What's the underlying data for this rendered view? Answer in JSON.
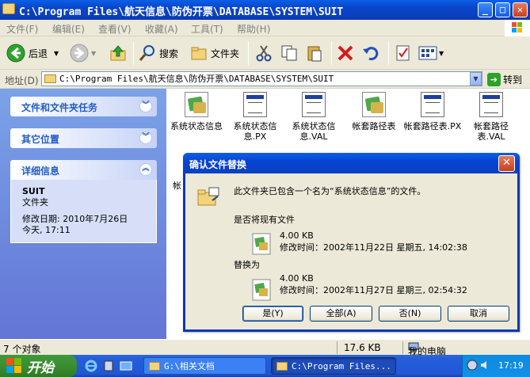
{
  "window": {
    "title": "C:\\Program Files\\航天信息\\防伪开票\\DATABASE\\SYSTEM\\SUIT",
    "controls": {
      "minimize": "_",
      "maximize": "□",
      "close": "✕"
    }
  },
  "menu": [
    "文件(F)",
    "编辑(E)",
    "查看(V)",
    "收藏(A)",
    "工具(T)",
    "帮助(H)"
  ],
  "toolbar": {
    "back": "后退",
    "search": "搜索",
    "folders": "文件夹"
  },
  "address": {
    "label": "地址(D)",
    "value": "C:\\Program Files\\航天信息\\防伪开票\\DATABASE\\SYSTEM\\SUIT",
    "go": "转到"
  },
  "sidebar": {
    "tasks_title": "文件和文件夹任务",
    "other_title": "其它位置",
    "details_title": "详细信息",
    "details": {
      "name": "SUIT",
      "type": "文件夹",
      "modified_label": "修改日期: 2010年7月26日",
      "modified_time": "今天, 17:11"
    }
  },
  "files": [
    {
      "name": "系统状态信息",
      "icon": "registry-icon"
    },
    {
      "name": "系统状态信息.PX",
      "icon": "document-icon"
    },
    {
      "name": "系统状态信息.VAL",
      "icon": "document-icon"
    },
    {
      "name": "帐套路径表",
      "icon": "registry-icon"
    },
    {
      "name": "帐套路径表.PX",
      "icon": "document-icon"
    },
    {
      "name": "帐套路径表.VAL",
      "icon": "document-icon"
    }
  ],
  "partial_file_label": "帐",
  "dialog": {
    "title": "确认文件替换",
    "message": "此文件夹已包含一个名为“系统状态信息”的文件。",
    "question": "是否将现有文件",
    "existing": {
      "size": "4.00 KB",
      "modified": "修改时间：2002年11月22日 星期五, 14:02:38"
    },
    "replace_with": "替换为",
    "new": {
      "size": "4.00 KB",
      "modified": "修改时间：2002年11月27日 星期三, 02:54:32"
    },
    "buttons": {
      "yes": "是(Y)",
      "yes_all": "全部(A)",
      "no": "否(N)",
      "cancel": "取消"
    }
  },
  "status": {
    "objects": "7 个对象",
    "size": "17.6 KB",
    "location": "我的电脑"
  },
  "taskbar": {
    "start": "开始",
    "tasks": [
      {
        "label": "G:\\相关文档"
      },
      {
        "label": "C:\\Program Files..."
      }
    ],
    "clock": "17:19"
  }
}
